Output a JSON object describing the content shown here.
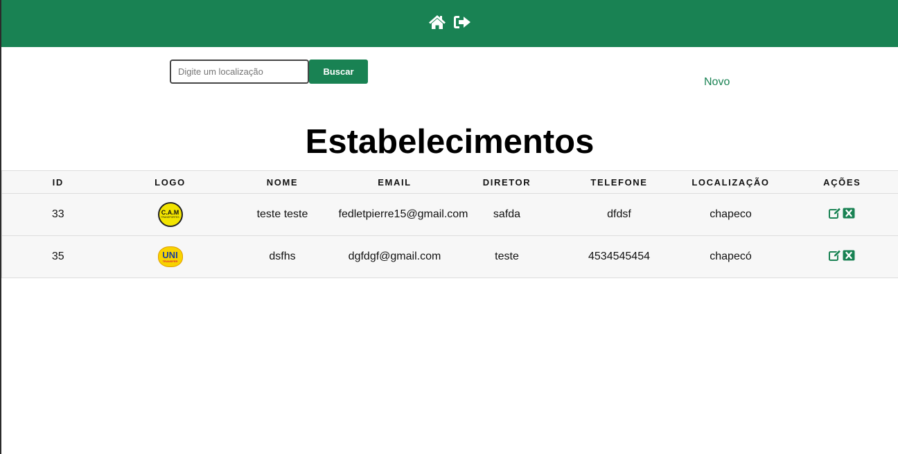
{
  "topbar": {
    "icons": [
      "home-icon",
      "logout-icon"
    ],
    "color": "#198253"
  },
  "search": {
    "placeholder": "Digite um localização",
    "value": "",
    "button_label": "Buscar"
  },
  "new_link_label": "Novo",
  "page_title": "Estabelecimentos",
  "table": {
    "headers": [
      "ID",
      "LOGO",
      "NOME",
      "EMAIL",
      "DIRETOR",
      "TELEFONE",
      "LOCALIZAÇÃO",
      "AÇÕES"
    ],
    "rows": [
      {
        "id": "33",
        "logo": {
          "text": "C.A.M",
          "subtext": "TRANSPORTES"
        },
        "nome": "teste teste",
        "email": "fedletpierre15@gmail.com",
        "diretor": "safda",
        "telefone": "dfdsf",
        "localizacao": "chapeco",
        "actions": [
          "edit-icon",
          "delete-icon"
        ]
      },
      {
        "id": "35",
        "logo": {
          "text": "UNI",
          "subtext": "TRANSFER"
        },
        "nome": "dsfhs",
        "email": "dgfdgf@gmail.com",
        "diretor": "teste",
        "telefone": "4534545454",
        "localizacao": "chapecó",
        "actions": [
          "edit-icon",
          "delete-icon"
        ]
      }
    ]
  }
}
